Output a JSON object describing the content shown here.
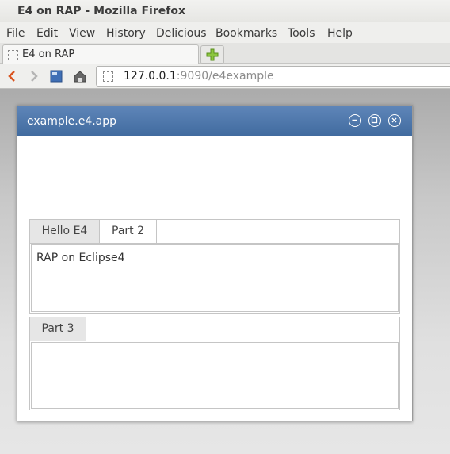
{
  "window": {
    "title": "E4 on RAP - Mozilla Firefox"
  },
  "menubar": {
    "items": [
      {
        "label": "File",
        "accel": "F"
      },
      {
        "label": "Edit"
      },
      {
        "label": "View"
      },
      {
        "label": "History"
      },
      {
        "label": "Delicious"
      },
      {
        "label": "Bookmarks"
      },
      {
        "label": "Tools"
      },
      {
        "label": "Help"
      }
    ]
  },
  "tabs": {
    "active_tab_label": "E4 on RAP"
  },
  "navbar": {
    "url_host": "127.0.0.1",
    "url_rest": ":9090/e4example"
  },
  "app": {
    "title": "example.e4.app",
    "partstack1": {
      "tabs": [
        "Hello E4",
        "Part 2"
      ],
      "active_index": 0,
      "content": "RAP on Eclipse4"
    },
    "partstack2": {
      "tabs": [
        "Part 3"
      ],
      "active_index": 0
    }
  },
  "colors": {
    "app_titlebar": "#4f79ad",
    "back_arrow": "#d9531e"
  }
}
